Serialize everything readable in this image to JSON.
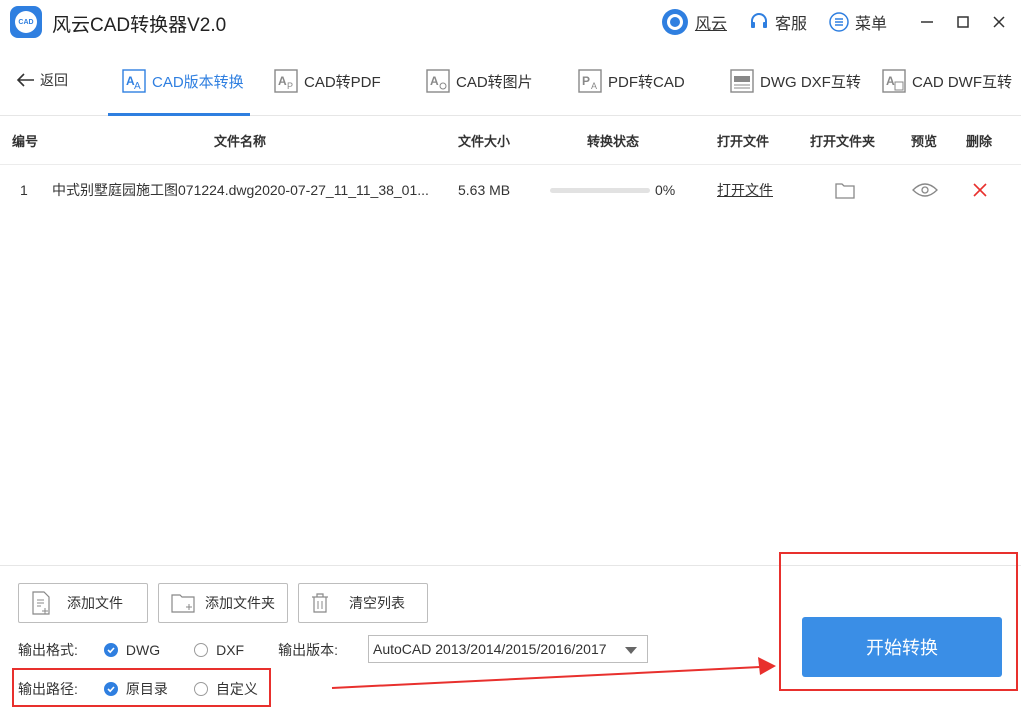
{
  "app": {
    "title": "风云CAD转换器V2.0",
    "logo_text": "CAD"
  },
  "titlebar": {
    "user_label": "风云",
    "service_label": "客服",
    "menu_label": "菜单"
  },
  "nav": {
    "back_label": "返回",
    "tabs": [
      {
        "label": "CAD版本转换",
        "icon": "aa-icon"
      },
      {
        "label": "CAD转PDF",
        "icon": "ap-icon"
      },
      {
        "label": "CAD转图片",
        "icon": "image-icon"
      },
      {
        "label": "PDF转CAD",
        "icon": "pdf-icon"
      },
      {
        "label": "DWG DXF互转",
        "icon": "dwg-icon"
      },
      {
        "label": "CAD DWF互转",
        "icon": "dwf-icon"
      }
    ],
    "active_tab": 0
  },
  "table": {
    "headers": [
      "编号",
      "文件名称",
      "文件大小",
      "转换状态",
      "打开文件",
      "打开文件夹",
      "预览",
      "删除"
    ],
    "rows": [
      {
        "index": "1",
        "filename": "中式别墅庭园施工图071224.dwg2020-07-27_11_11_38_01...",
        "size": "5.63 MB",
        "progress": 0,
        "progress_text": "0%",
        "open_label": "打开文件"
      }
    ]
  },
  "actions": {
    "add_file": "添加文件",
    "add_folder": "添加文件夹",
    "clear_list": "清空列表",
    "start": "开始转换"
  },
  "output": {
    "format_label": "输出格式:",
    "formats": [
      "DWG",
      "DXF"
    ],
    "selected_format": "DWG",
    "version_label": "输出版本:",
    "version_value": "AutoCAD 2013/2014/2015/2016/2017",
    "path_label": "输出路径:",
    "paths": [
      "原目录",
      "自定义"
    ],
    "selected_path": "原目录"
  },
  "colors": {
    "accent": "#2f7fe0",
    "start_button": "#3a8ee6",
    "annotation": "#e8302d",
    "delete": "#e8302d"
  }
}
